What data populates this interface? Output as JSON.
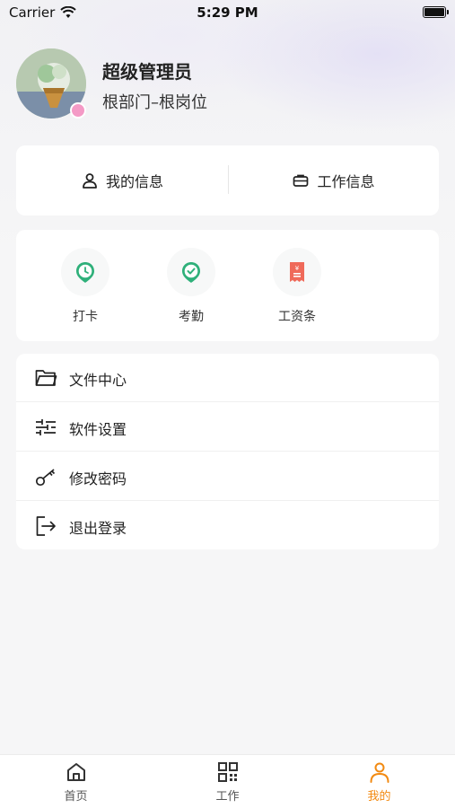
{
  "status_bar": {
    "carrier": "Carrier",
    "time": "5:29 PM"
  },
  "profile": {
    "name": "超级管理员",
    "department": "根部门–根岗位"
  },
  "info_card": {
    "my_info_label": "我的信息",
    "work_info_label": "工作信息"
  },
  "quick_actions": [
    {
      "label": "打卡",
      "icon": "clock-icon",
      "color": "#2fb07a"
    },
    {
      "label": "考勤",
      "icon": "check-circle-icon",
      "color": "#2fb07a"
    },
    {
      "label": "工资条",
      "icon": "payslip-icon",
      "color": "#ef6a5a"
    }
  ],
  "menu": [
    {
      "label": "文件中心",
      "icon": "folder-icon"
    },
    {
      "label": "软件设置",
      "icon": "sliders-icon"
    },
    {
      "label": "修改密码",
      "icon": "key-icon"
    },
    {
      "label": "退出登录",
      "icon": "logout-icon"
    }
  ],
  "tab_bar": [
    {
      "label": "首页",
      "icon": "home-icon"
    },
    {
      "label": "工作",
      "icon": "qrcode-icon"
    },
    {
      "label": "我的",
      "icon": "user-icon",
      "active": true
    }
  ],
  "colors": {
    "accent": "#f28a12",
    "green": "#2fb07a",
    "red": "#ef6a5a"
  }
}
